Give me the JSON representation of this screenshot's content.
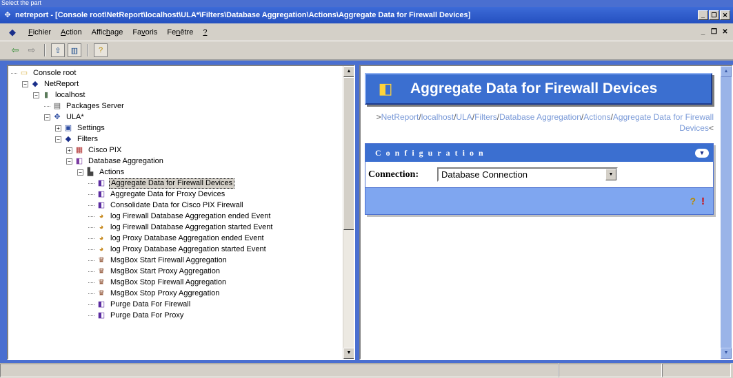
{
  "top_caption": "Select the part",
  "window": {
    "title": "netreport - [Console root\\NetReport\\localhost\\ULA*\\Filters\\Database Aggregation\\Actions\\Aggregate Data for Firewall Devices]"
  },
  "menu": {
    "items": [
      {
        "pre": "",
        "u": "F",
        "post": "ichier"
      },
      {
        "pre": "",
        "u": "A",
        "post": "ction"
      },
      {
        "pre": "Affic",
        "u": "h",
        "post": "age"
      },
      {
        "pre": "Fa",
        "u": "v",
        "post": "oris"
      },
      {
        "pre": "Fe",
        "u": "n",
        "post": "être"
      },
      {
        "pre": "",
        "u": "?",
        "post": ""
      }
    ]
  },
  "tree": {
    "items": [
      {
        "label": "Console root",
        "icon": "folder-icon",
        "glyph": "▭",
        "color": "#d8b040",
        "depth": 0,
        "exp": ""
      },
      {
        "label": "NetReport",
        "icon": "netreport-icon",
        "glyph": "◆",
        "color": "#1a2f8a",
        "depth": 1,
        "exp": "−"
      },
      {
        "label": "localhost",
        "icon": "computer-icon",
        "glyph": "▮",
        "color": "#5a7a5a",
        "depth": 2,
        "exp": "−"
      },
      {
        "label": "Packages Server",
        "icon": "server-icon",
        "glyph": "▤",
        "color": "#555",
        "depth": 3,
        "exp": ""
      },
      {
        "label": "ULA*",
        "icon": "ula-icon",
        "glyph": "✥",
        "color": "#2a4aa0",
        "depth": 3,
        "exp": "−"
      },
      {
        "label": "Settings",
        "icon": "settings-icon",
        "glyph": "▣",
        "color": "#2a4aa0",
        "depth": 4,
        "exp": "+"
      },
      {
        "label": "Filters",
        "icon": "filters-icon",
        "glyph": "◆",
        "color": "#1a2f8a",
        "depth": 4,
        "exp": "−"
      },
      {
        "label": "Cisco PIX",
        "icon": "cisco-icon",
        "glyph": "▦",
        "color": "#b03030",
        "depth": 5,
        "exp": "+"
      },
      {
        "label": "Database Aggregation",
        "icon": "database-icon",
        "glyph": "◧",
        "color": "#7a3aa0",
        "depth": 5,
        "exp": "−"
      },
      {
        "label": "Actions",
        "icon": "actions-icon",
        "glyph": "▙",
        "color": "#444",
        "depth": 6,
        "exp": "−"
      },
      {
        "label": "Aggregate Data for Firewall Devices",
        "icon": "action-data-icon",
        "glyph": "◧",
        "color": "#5a2aa0",
        "depth": 7,
        "exp": "",
        "selected": true
      },
      {
        "label": "Aggregate Data for Proxy Devices",
        "icon": "action-data-icon",
        "glyph": "◧",
        "color": "#5a2aa0",
        "depth": 7,
        "exp": ""
      },
      {
        "label": "Consolidate Data for Cisco PIX Firewall",
        "icon": "action-data-icon",
        "glyph": "◧",
        "color": "#5a2aa0",
        "depth": 7,
        "exp": ""
      },
      {
        "label": "log Firewall Database Aggregation ended Event",
        "icon": "log-event-icon",
        "glyph": "◕",
        "color": "#c88a20",
        "depth": 7,
        "exp": ""
      },
      {
        "label": "log Firewall Database Aggregation started Event",
        "icon": "log-event-icon",
        "glyph": "◕",
        "color": "#c88a20",
        "depth": 7,
        "exp": ""
      },
      {
        "label": "log Proxy Database Aggregation ended Event",
        "icon": "log-event-icon",
        "glyph": "◕",
        "color": "#c88a20",
        "depth": 7,
        "exp": ""
      },
      {
        "label": "log Proxy Database Aggregation started Event",
        "icon": "log-event-icon",
        "glyph": "◕",
        "color": "#c88a20",
        "depth": 7,
        "exp": ""
      },
      {
        "label": "MsgBox Start Firewall Aggregation",
        "icon": "msgbox-icon",
        "glyph": "♛",
        "color": "#8a4a2a",
        "depth": 7,
        "exp": ""
      },
      {
        "label": "MsgBox Start Proxy Aggregation",
        "icon": "msgbox-icon",
        "glyph": "♛",
        "color": "#8a4a2a",
        "depth": 7,
        "exp": ""
      },
      {
        "label": "MsgBox Stop Firewall Aggregation",
        "icon": "msgbox-icon",
        "glyph": "♛",
        "color": "#8a4a2a",
        "depth": 7,
        "exp": ""
      },
      {
        "label": "MsgBox Stop Proxy Aggregation",
        "icon": "msgbox-icon",
        "glyph": "♛",
        "color": "#8a4a2a",
        "depth": 7,
        "exp": ""
      },
      {
        "label": "Purge Data For Firewall",
        "icon": "action-data-icon",
        "glyph": "◧",
        "color": "#5a2aa0",
        "depth": 7,
        "exp": ""
      },
      {
        "label": "Purge Data For Proxy",
        "icon": "action-data-icon",
        "glyph": "◧",
        "color": "#5a2aa0",
        "depth": 7,
        "exp": ""
      }
    ]
  },
  "result": {
    "banner_title": "Aggregate Data for Firewall Devices",
    "breadcrumb": {
      "lead": ">",
      "parts": [
        "NetReport",
        "localhost",
        "ULA",
        "Filters",
        "Database Aggregation",
        "Actions",
        "Aggregate Data for Firewall Devices"
      ],
      "tail": "<"
    },
    "config": {
      "header": "Configuration",
      "connection_label": "Connection:",
      "connection_value": "Database Connection"
    }
  },
  "colors": {
    "title_bar": "#2450c0",
    "panel_blue": "#3b6fd0",
    "chrome": "#d4d0c8"
  }
}
